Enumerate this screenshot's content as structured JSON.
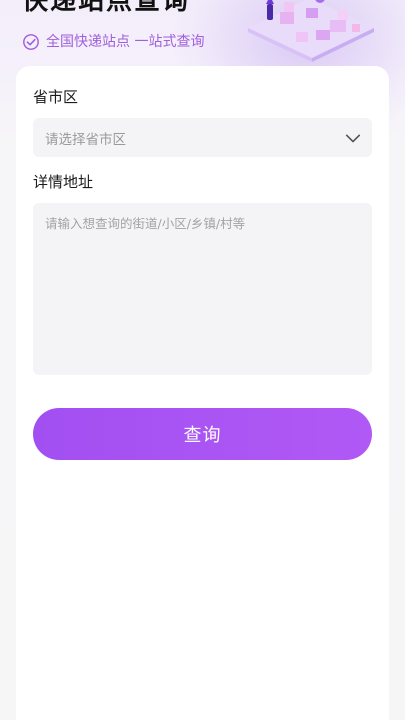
{
  "header": {
    "title": "快递站点查询",
    "subtitle": "全国快递站点 一站式查询",
    "check_icon": "check-circle-icon",
    "illustration": "parcel-station-illustration"
  },
  "form": {
    "region_label": "省市区",
    "region_placeholder": "请选择省市区",
    "address_label": "详情地址",
    "address_placeholder": "请输入想查询的街道/小区/乡镇/村等",
    "submit_label": "查询"
  },
  "colors": {
    "accent": "#a855f7",
    "subtitle": "#a05fdc"
  }
}
